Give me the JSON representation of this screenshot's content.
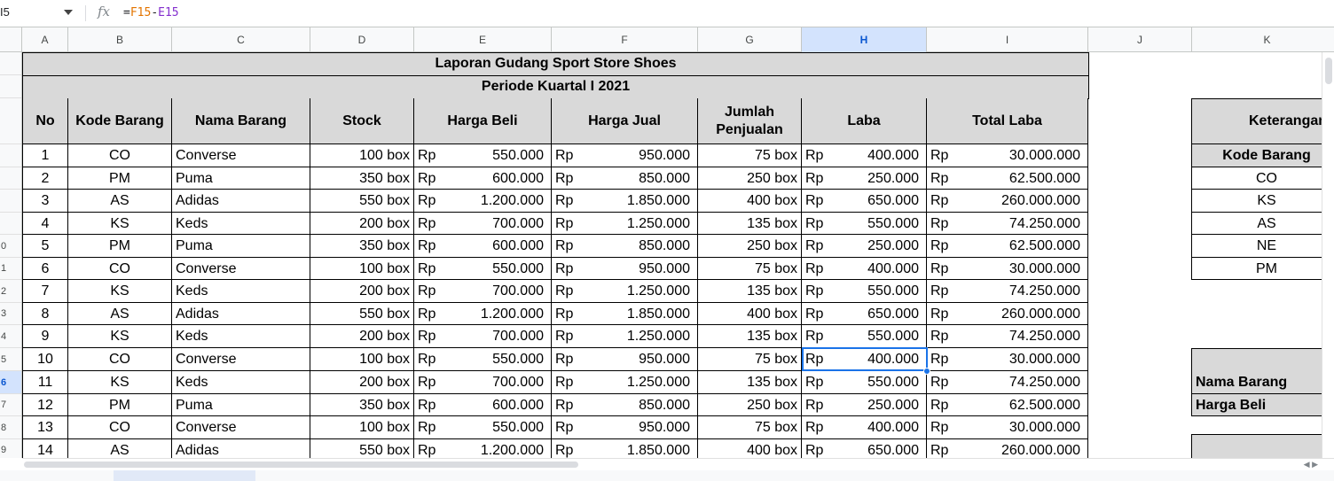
{
  "formula_bar": {
    "name_box": "I5",
    "fx_label": "fx",
    "formula_prefix": "=",
    "formula_ref1": "F15",
    "formula_op": "-",
    "formula_ref2": "E15"
  },
  "columns": [
    "A",
    "B",
    "C",
    "D",
    "E",
    "F",
    "G",
    "H",
    "I",
    "J",
    "K"
  ],
  "selected_column": "H",
  "row_numbers": [
    "",
    "",
    "",
    "",
    "",
    "",
    "",
    "0",
    "1",
    "2",
    "3",
    "4",
    "5",
    "6",
    "7",
    "8",
    "9"
  ],
  "selected_row_index": 13,
  "report": {
    "title": "Laporan Gudang Sport Store Shoes",
    "period": "Periode Kuartal I 2021",
    "headers": {
      "no": "No",
      "kode": "Kode Barang",
      "nama": "Nama Barang",
      "stock": "Stock",
      "harga_beli": "Harga Beli",
      "harga_jual": "Harga Jual",
      "jumlah": "Jumlah Penjualan",
      "laba": "Laba",
      "total_laba": "Total Laba"
    },
    "currency": "Rp",
    "rows": [
      [
        "1",
        "CO",
        "Converse",
        "100 box",
        "550.000",
        "950.000",
        "75 box",
        "400.000",
        "30.000.000"
      ],
      [
        "2",
        "PM",
        "Puma",
        "350 box",
        "600.000",
        "850.000",
        "250 box",
        "250.000",
        "62.500.000"
      ],
      [
        "3",
        "AS",
        "Adidas",
        "550 box",
        "1.200.000",
        "1.850.000",
        "400 box",
        "650.000",
        "260.000.000"
      ],
      [
        "4",
        "KS",
        "Keds",
        "200 box",
        "700.000",
        "1.250.000",
        "135 box",
        "550.000",
        "74.250.000"
      ],
      [
        "5",
        "PM",
        "Puma",
        "350 box",
        "600.000",
        "850.000",
        "250 box",
        "250.000",
        "62.500.000"
      ],
      [
        "6",
        "CO",
        "Converse",
        "100 box",
        "550.000",
        "950.000",
        "75 box",
        "400.000",
        "30.000.000"
      ],
      [
        "7",
        "KS",
        "Keds",
        "200 box",
        "700.000",
        "1.250.000",
        "135 box",
        "550.000",
        "74.250.000"
      ],
      [
        "8",
        "AS",
        "Adidas",
        "550 box",
        "1.200.000",
        "1.850.000",
        "400 box",
        "650.000",
        "260.000.000"
      ],
      [
        "9",
        "KS",
        "Keds",
        "200 box",
        "700.000",
        "1.250.000",
        "135 box",
        "550.000",
        "74.250.000"
      ],
      [
        "10",
        "CO",
        "Converse",
        "100 box",
        "550.000",
        "950.000",
        "75 box",
        "400.000",
        "30.000.000"
      ],
      [
        "11",
        "KS",
        "Keds",
        "200 box",
        "700.000",
        "1.250.000",
        "135 box",
        "550.000",
        "74.250.000"
      ],
      [
        "12",
        "PM",
        "Puma",
        "350 box",
        "600.000",
        "850.000",
        "250 box",
        "250.000",
        "62.500.000"
      ],
      [
        "13",
        "CO",
        "Converse",
        "100 box",
        "550.000",
        "950.000",
        "75 box",
        "400.000",
        "30.000.000"
      ],
      [
        "14",
        "AS",
        "Adidas",
        "550 box",
        "1.200.000",
        "1.850.000",
        "400 box",
        "650.000",
        "260.000.000"
      ]
    ],
    "selected_data_row": 9,
    "selected_value": "400.000"
  },
  "side_table": {
    "title": "Keterangan",
    "kode_header": "Kode Barang",
    "codes": [
      "CO",
      "KS",
      "AS",
      "NE",
      "PM"
    ],
    "label_nama": "Nama Barang",
    "label_harga": "Harga Beli"
  }
}
